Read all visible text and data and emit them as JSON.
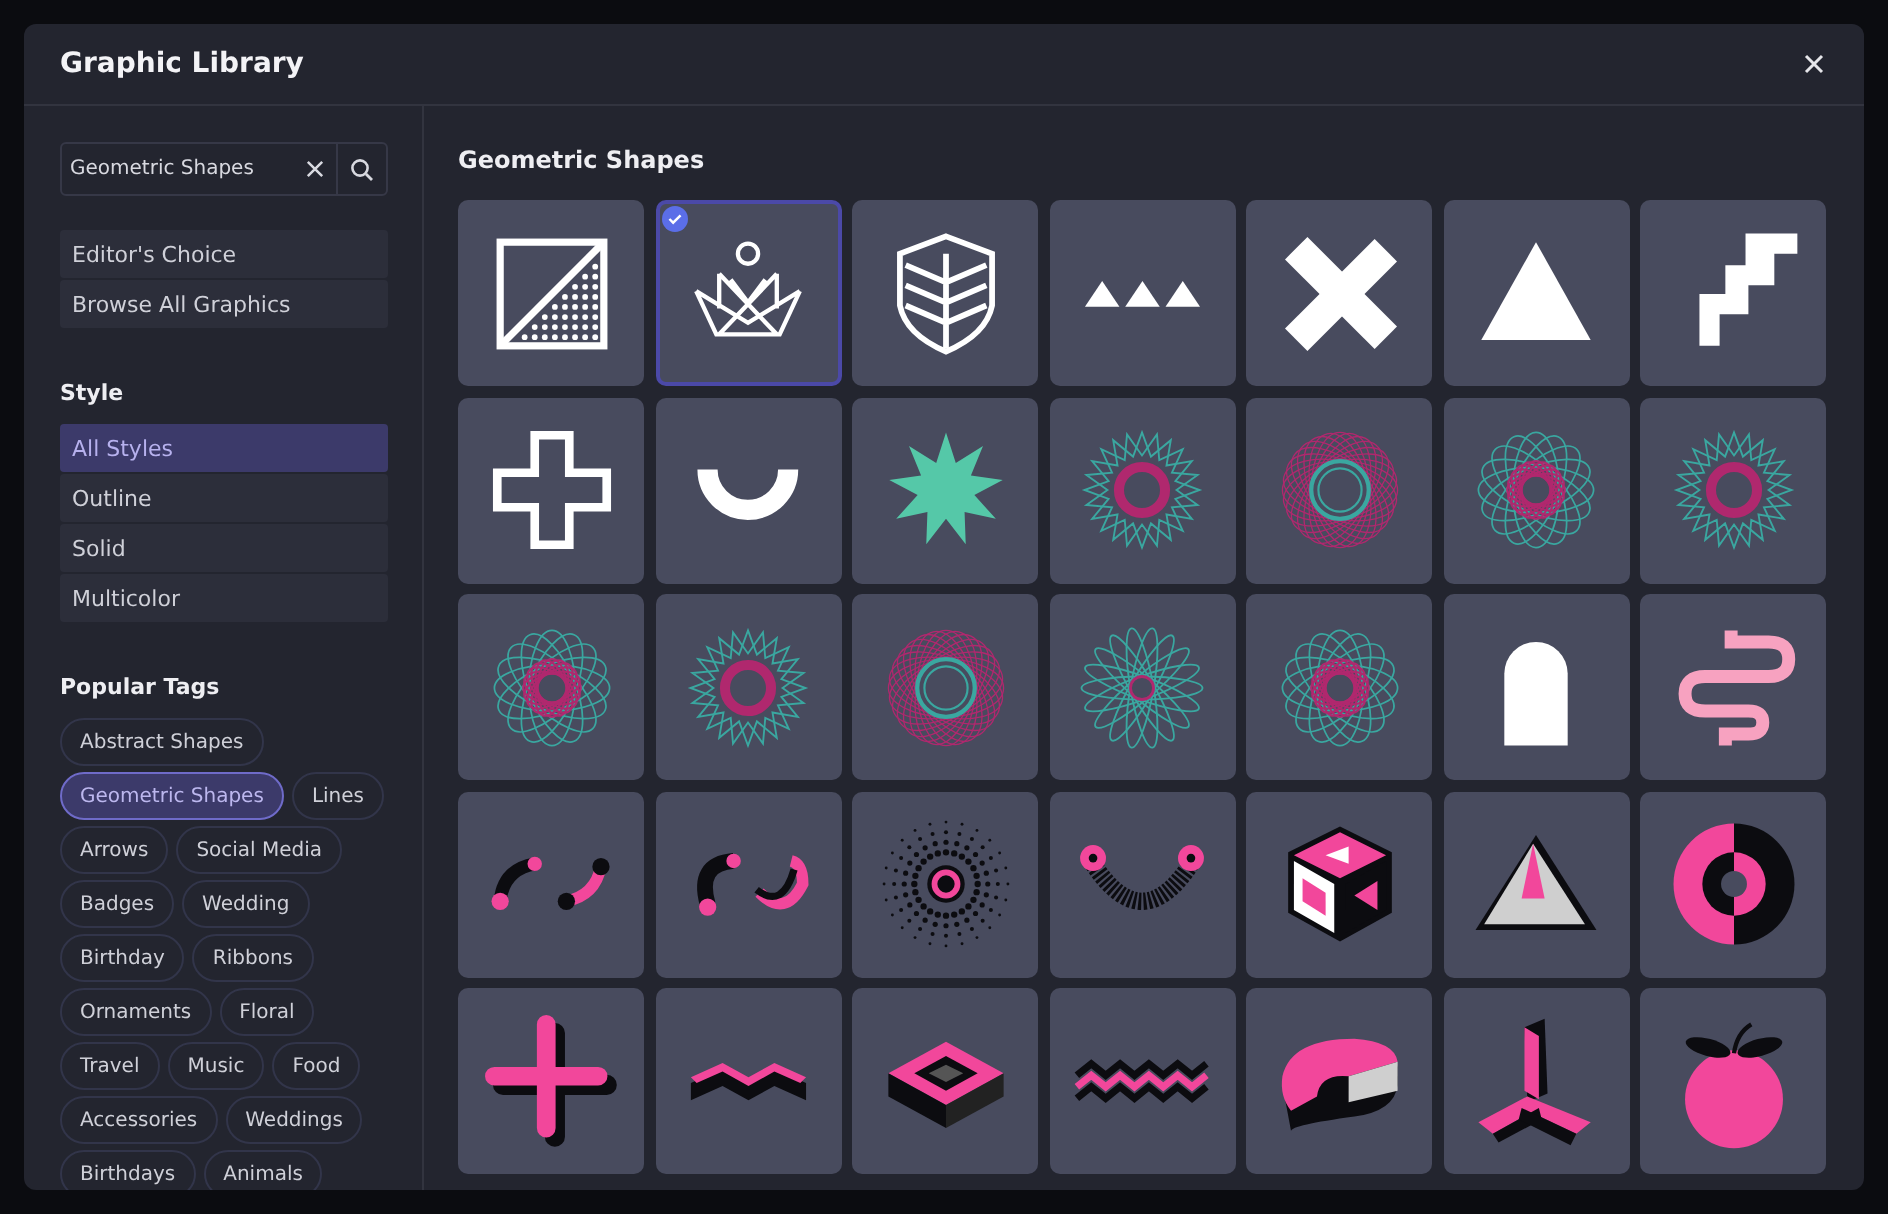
{
  "window": {
    "title": "Graphic Library"
  },
  "search": {
    "value": "Geometric Shapes"
  },
  "nav_items": [
    "Editor's Choice",
    "Browse All Graphics"
  ],
  "style": {
    "heading": "Style",
    "items": [
      {
        "label": "All Styles",
        "selected": true
      },
      {
        "label": "Outline",
        "selected": false
      },
      {
        "label": "Solid",
        "selected": false
      },
      {
        "label": "Multicolor",
        "selected": false
      }
    ]
  },
  "popular_tags": {
    "heading": "Popular Tags",
    "tags": [
      {
        "label": "Abstract Shapes",
        "selected": false
      },
      {
        "label": "Geometric Shapes",
        "selected": true
      },
      {
        "label": "Lines",
        "selected": false
      },
      {
        "label": "Arrows",
        "selected": false
      },
      {
        "label": "Social Media",
        "selected": false
      },
      {
        "label": "Badges",
        "selected": false
      },
      {
        "label": "Wedding",
        "selected": false
      },
      {
        "label": "Birthday",
        "selected": false
      },
      {
        "label": "Ribbons",
        "selected": false
      },
      {
        "label": "Ornaments",
        "selected": false
      },
      {
        "label": "Floral",
        "selected": false
      },
      {
        "label": "Travel",
        "selected": false
      },
      {
        "label": "Music",
        "selected": false
      },
      {
        "label": "Food",
        "selected": false
      },
      {
        "label": "Accessories",
        "selected": false
      },
      {
        "label": "Weddings",
        "selected": false
      },
      {
        "label": "Birthdays",
        "selected": false
      },
      {
        "label": "Animals",
        "selected": false
      }
    ]
  },
  "gallery": {
    "heading": "Geometric Shapes",
    "graphics": [
      {
        "kind": "split-square",
        "selected": false
      },
      {
        "kind": "crown",
        "selected": true
      },
      {
        "kind": "shield",
        "selected": false
      },
      {
        "kind": "triangles",
        "selected": false
      },
      {
        "kind": "cross",
        "selected": false
      },
      {
        "kind": "triangle",
        "selected": false
      },
      {
        "kind": "stairs",
        "selected": false
      },
      {
        "kind": "plus-outline",
        "selected": false
      },
      {
        "kind": "arc",
        "selected": false
      },
      {
        "kind": "starburst",
        "selected": false
      },
      {
        "kind": "spiro-star",
        "selected": false
      },
      {
        "kind": "spiro-ring",
        "selected": false
      },
      {
        "kind": "spiro-flower",
        "selected": false
      },
      {
        "kind": "spiro-star",
        "selected": false
      },
      {
        "kind": "spiro-flower",
        "selected": false
      },
      {
        "kind": "spiro-star",
        "selected": false
      },
      {
        "kind": "spiro-ring",
        "selected": false
      },
      {
        "kind": "petal-flower",
        "selected": false
      },
      {
        "kind": "spiro-flower",
        "selected": false
      },
      {
        "kind": "arch",
        "selected": false
      },
      {
        "kind": "squiggle",
        "selected": false
      },
      {
        "kind": "curved-links",
        "selected": false
      },
      {
        "kind": "hooks",
        "selected": false
      },
      {
        "kind": "dot-burst",
        "selected": false
      },
      {
        "kind": "smile-dots",
        "selected": false
      },
      {
        "kind": "cube",
        "selected": false
      },
      {
        "kind": "pyramid",
        "selected": false
      },
      {
        "kind": "split-ring",
        "selected": false
      },
      {
        "kind": "plus-3d",
        "selected": false
      },
      {
        "kind": "zigzag-3d",
        "selected": false
      },
      {
        "kind": "square-frame-3d",
        "selected": false
      },
      {
        "kind": "zigzag-stripe",
        "selected": false
      },
      {
        "kind": "donut-3d",
        "selected": false
      },
      {
        "kind": "tripod-3d",
        "selected": false
      },
      {
        "kind": "fruit",
        "selected": false
      }
    ]
  }
}
